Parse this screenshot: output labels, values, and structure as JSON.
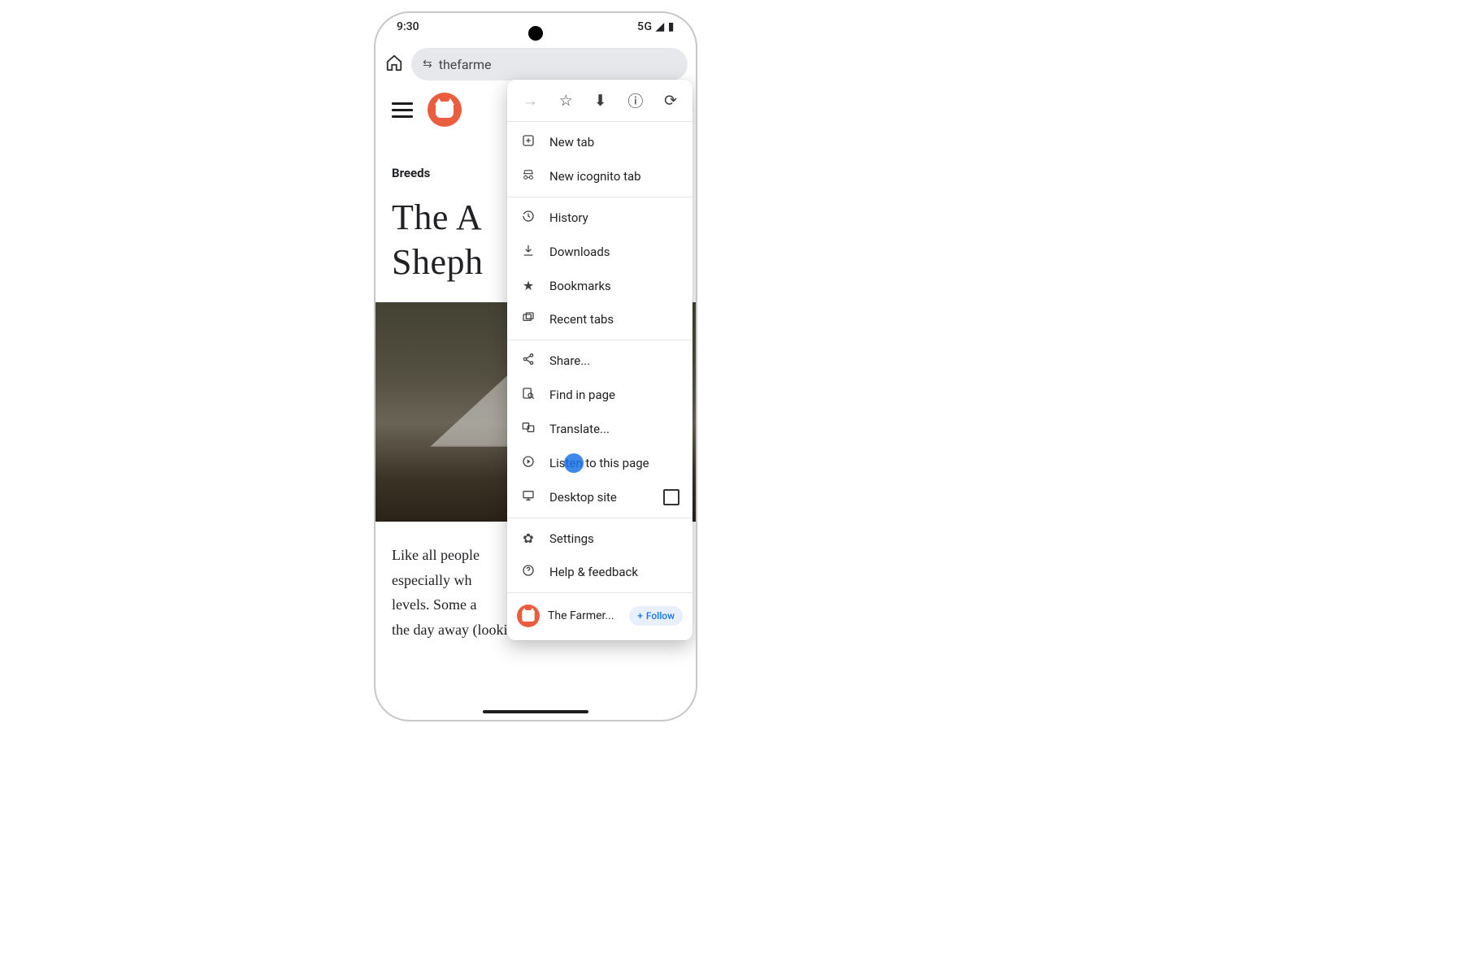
{
  "status": {
    "time": "9:30",
    "network": "5G"
  },
  "omnibox": {
    "url_text": "thefarme"
  },
  "site": {
    "category": "Breeds",
    "headline": "The A\nSheph",
    "body": "Like all people\nespecially wh\nlevels. Some a\nthe day away (looking at you, pugs)."
  },
  "menu": {
    "sections": [
      [
        "New tab",
        "New icognito tab"
      ],
      [
        "History",
        "Downloads",
        "Bookmarks",
        "Recent tabs"
      ],
      [
        "Share...",
        "Find in page",
        "Translate...",
        "Listen to this page",
        "Desktop site"
      ],
      [
        "Settings",
        "Help & feedback"
      ]
    ],
    "follow_site": "The Farmer...",
    "follow_label": "Follow"
  }
}
